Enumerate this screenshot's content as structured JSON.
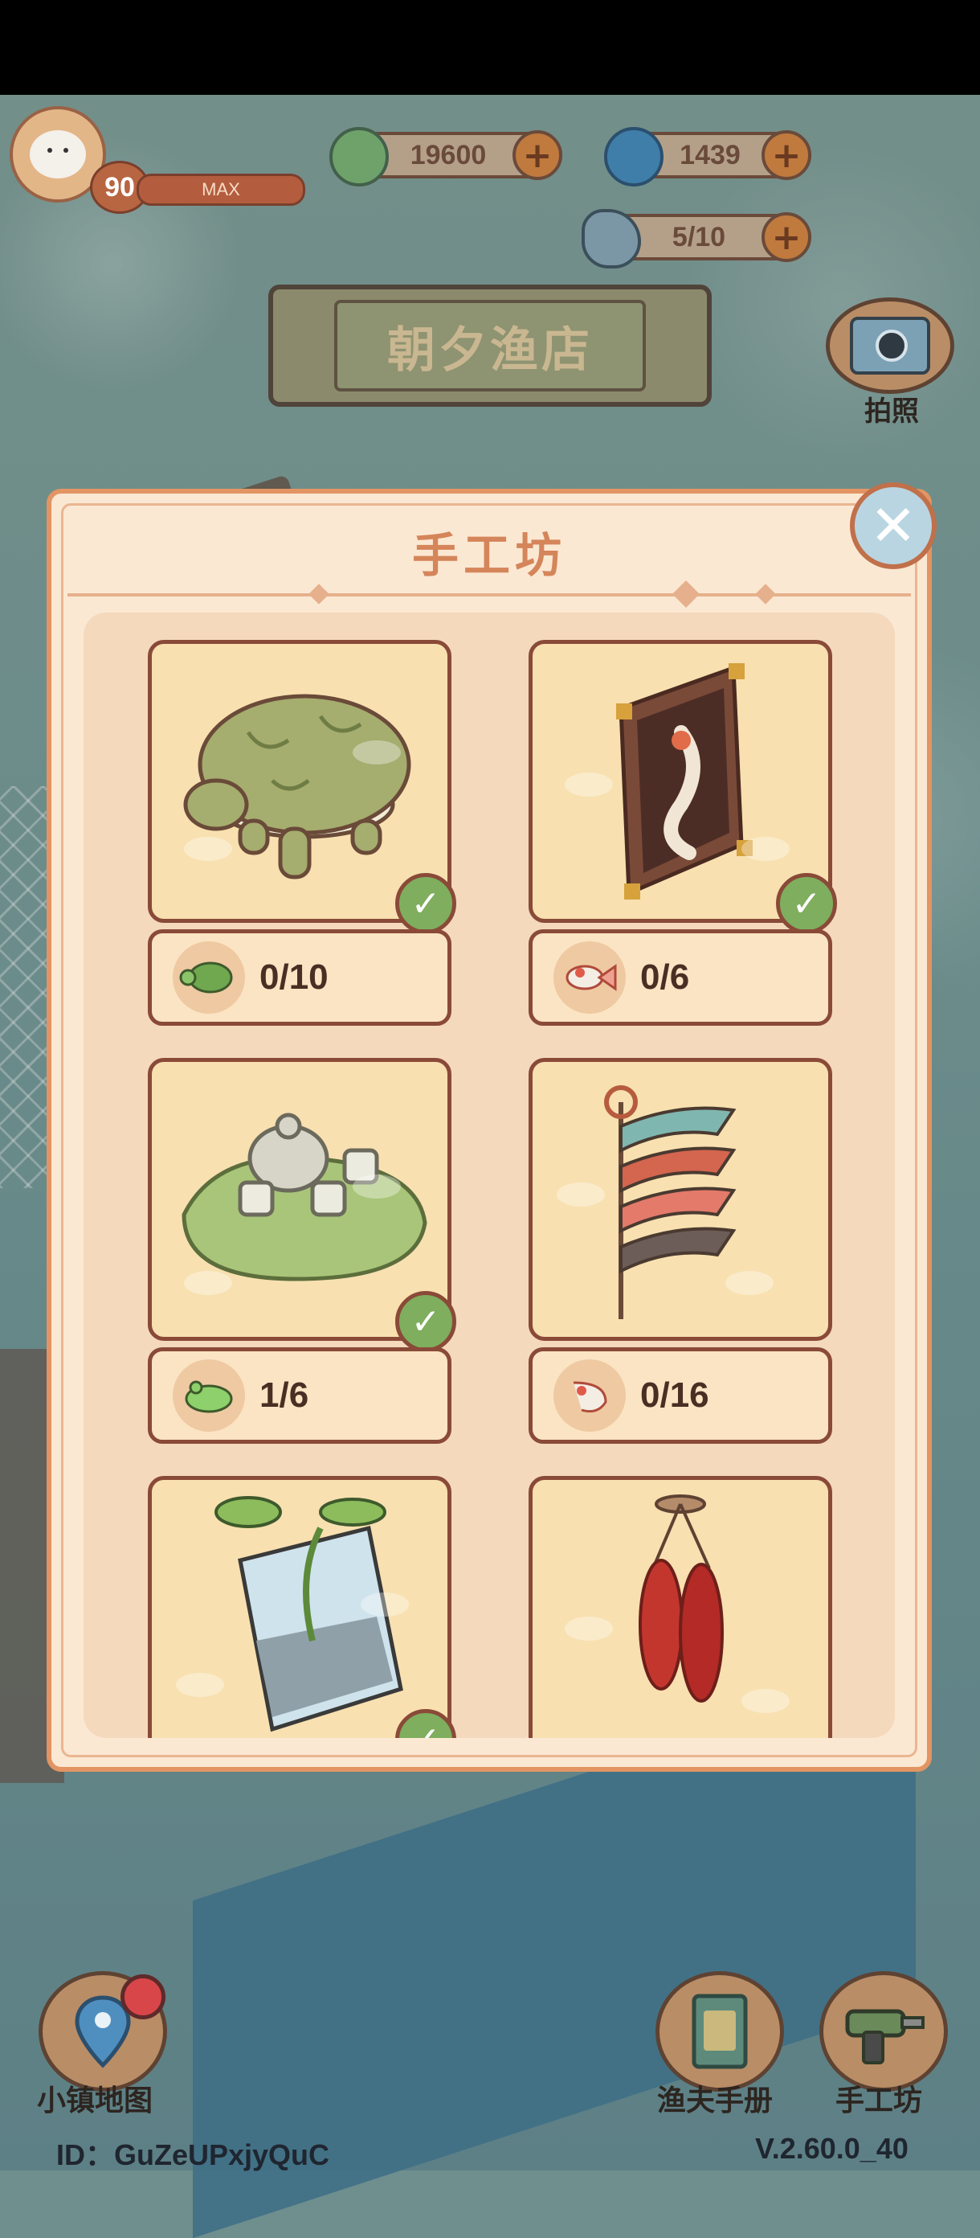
{
  "player": {
    "level": "90",
    "level_bar_label": "MAX"
  },
  "currencies": {
    "clover": "19600",
    "spiral": "1439",
    "fish_capacity": "5/10"
  },
  "shop_sign": {
    "title": "朝夕渔店"
  },
  "camera": {
    "label": "拍照"
  },
  "modal": {
    "title": "手工坊",
    "items": [
      {
        "name": "turtle",
        "counter": "0/10",
        "completed": true,
        "counter_icon": "turtle-icon"
      },
      {
        "name": "fish-painting",
        "counter": "0/6",
        "completed": true,
        "counter_icon": "goldfish-icon"
      },
      {
        "name": "frog-tea-set",
        "counter": "1/6",
        "completed": true,
        "counter_icon": "frog-icon"
      },
      {
        "name": "carp-streamer",
        "counter": "0/16",
        "completed": false,
        "counter_icon": "koi-icon"
      },
      {
        "name": "plant-aquarium",
        "counter": "",
        "completed": true,
        "counter_icon": ""
      },
      {
        "name": "hanging-crawfish",
        "counter": "",
        "completed": false,
        "counter_icon": ""
      }
    ]
  },
  "bottom_nav": {
    "map_label": "小镇地图",
    "handbook_label": "渔夫手册",
    "workshop_label": "手工坊"
  },
  "footer": {
    "id_text": "ID：GuZeUPxjyQuC",
    "version": "V.2.60.0_40"
  },
  "colors": {
    "modal_bg": "#fbe8d3",
    "modal_border": "#e29563",
    "title_color": "#d5855a",
    "card_border": "#8a4a38",
    "check_green": "#7fae5e"
  }
}
